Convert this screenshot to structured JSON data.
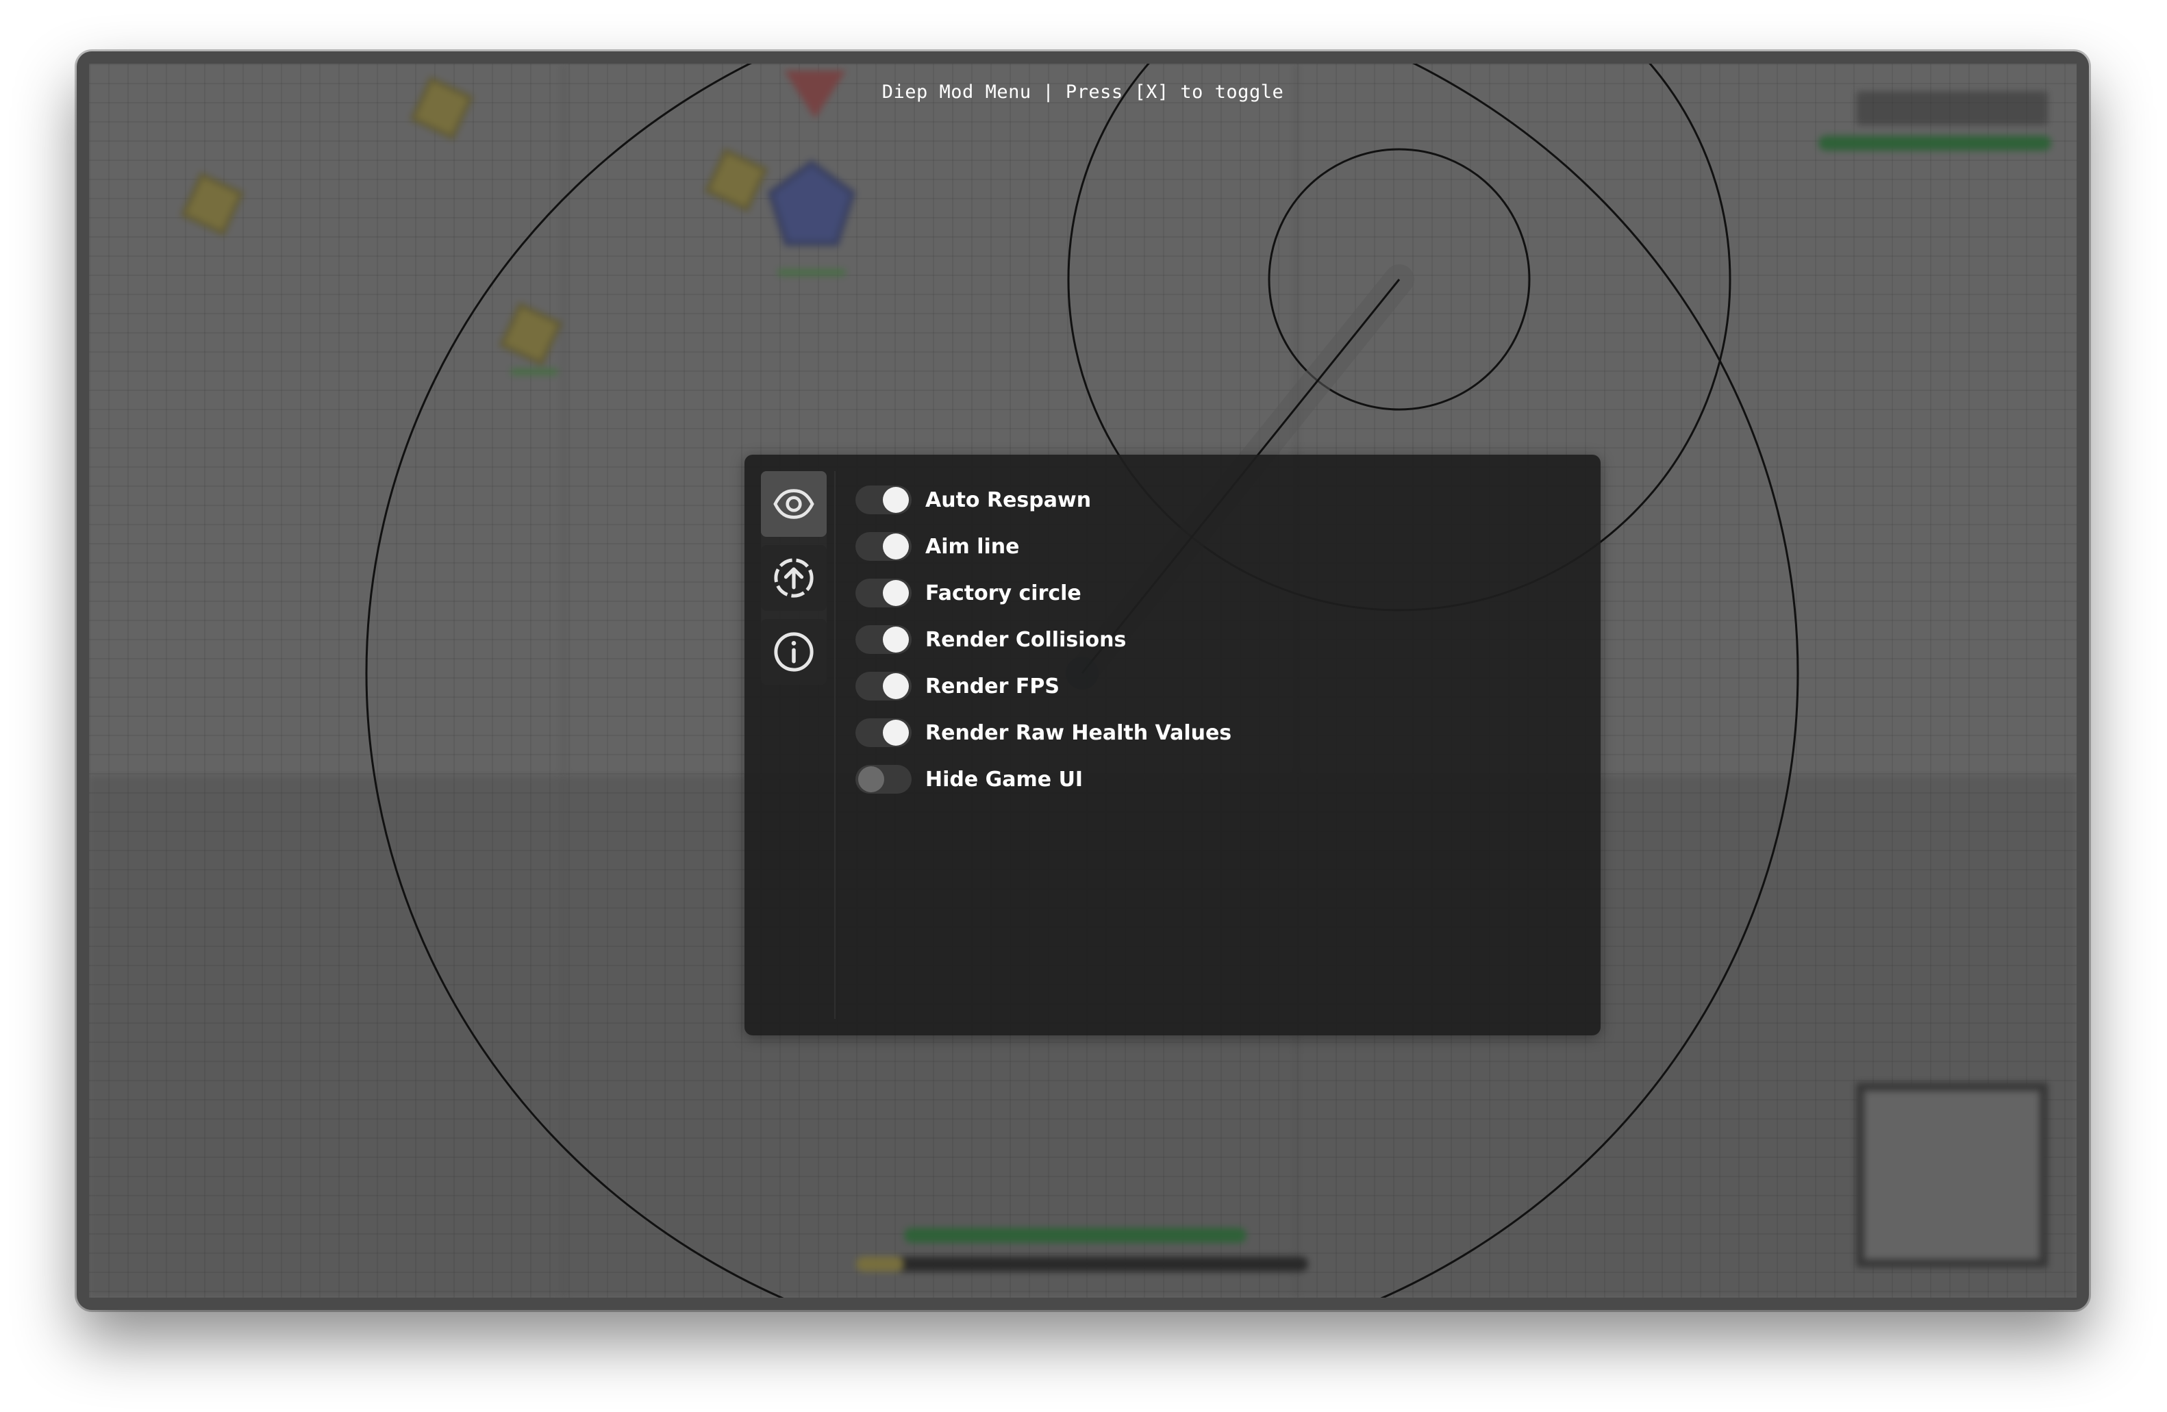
{
  "header": {
    "title": "Diep Mod Menu | Press [X] to toggle"
  },
  "menu": {
    "tabs": [
      {
        "icon": "eye-icon",
        "active": true
      },
      {
        "icon": "upgrade-arrow-icon",
        "active": false
      },
      {
        "icon": "info-icon",
        "active": false
      }
    ],
    "options": [
      {
        "label": "Auto Respawn",
        "enabled": true
      },
      {
        "label": "Aim line",
        "enabled": true
      },
      {
        "label": "Factory circle",
        "enabled": true
      },
      {
        "label": "Render Collisions",
        "enabled": true
      },
      {
        "label": "Render FPS",
        "enabled": true
      },
      {
        "label": "Render Raw Health Values",
        "enabled": true
      },
      {
        "label": "Hide Game UI",
        "enabled": false
      }
    ]
  },
  "colors": {
    "game_bg": "#cdcdcd",
    "square": "#ffe869",
    "pentagon": "#768dfc",
    "triangle": "#fc7677",
    "menu_bg": "#1e1e1e",
    "toggle_on_knob": "#f2f2f2",
    "toggle_off_knob": "#6a6a6a"
  }
}
